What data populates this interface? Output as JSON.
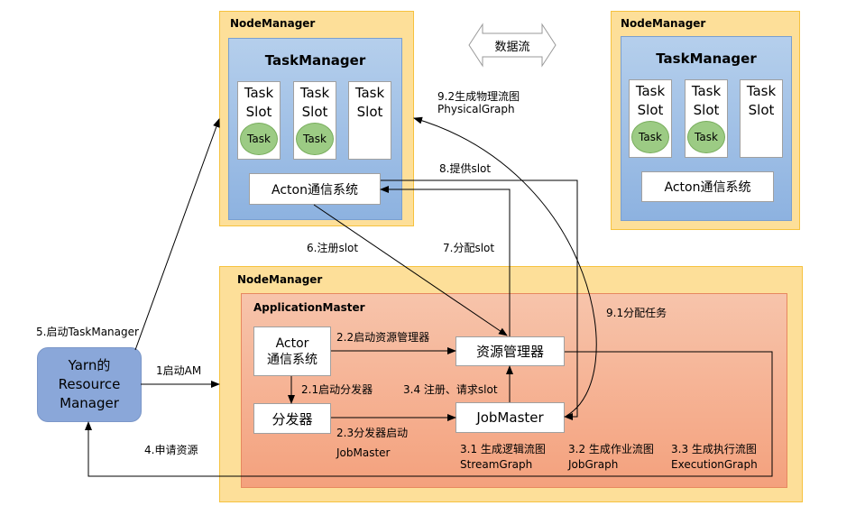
{
  "node_managers": {
    "label": "NodeManager"
  },
  "task_manager": {
    "title": "TaskManager",
    "slot_line1": "Task",
    "slot_line2": "Slot",
    "task": "Task",
    "acton": "Acton通信系统"
  },
  "dataflow": "数据流",
  "application_master": {
    "title": "ApplicationMaster",
    "actor_line1": "Actor",
    "actor_line2": "通信系统",
    "resource_manager": "资源管理器",
    "dispatcher": "分发器",
    "jobmaster": "JobMaster"
  },
  "yarn": {
    "line1": "Yarn的",
    "line2": "Resource",
    "line3": "Manager"
  },
  "labels": {
    "s1": "1启动AM",
    "s4": "4.申请资源",
    "s5": "5.启动TaskManager",
    "s6": "6.注册slot",
    "s7": "7.分配slot",
    "s8": "8.提供slot",
    "s91": "9.1分配任务",
    "s92a": "9.2生成物理流图",
    "s92b": "PhysicalGraph",
    "s21": "2.1启动分发器",
    "s22": "2.2启动资源管理器",
    "s23a": "2.3分发器启动",
    "s23b": "JobMaster",
    "s34": "3.4 注册、请求slot",
    "s31a": "3.1 生成逻辑流图",
    "s31b": "StreamGraph",
    "s32a": "3.2 生成作业流图",
    "s32b": "JobGraph",
    "s33a": "3.3 生成执行流图",
    "s33b": "ExecutionGraph"
  }
}
